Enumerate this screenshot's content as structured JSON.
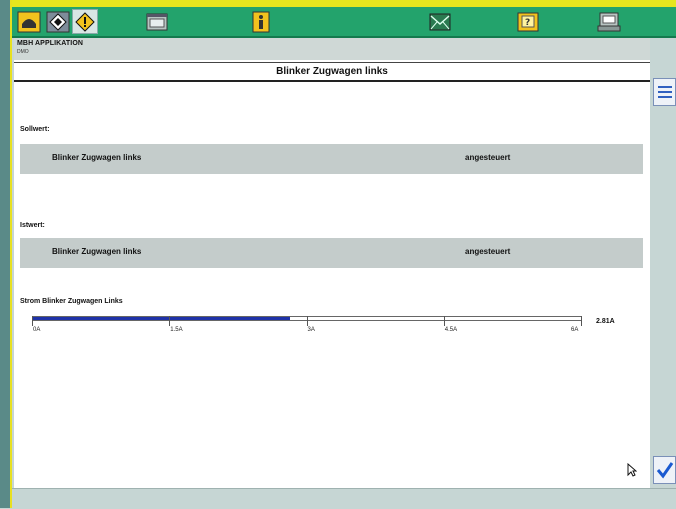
{
  "app": {
    "title": "MBH APPLIKATION",
    "subtitle": "DMO"
  },
  "toolbar": {
    "buttons": [
      {
        "name": "vehicle-icon",
        "color": "#f2c21e"
      },
      {
        "name": "diagnosis-icon",
        "color": "#7e8c9a"
      },
      {
        "name": "warning-diamond-icon",
        "color": "#f2c21e"
      },
      {
        "name": "window-icon",
        "color": "#b8c4c2"
      },
      {
        "name": "info-icon",
        "color": "#f2c21e"
      },
      {
        "name": "message-icon",
        "color": "#2a7a50"
      },
      {
        "name": "help-icon",
        "color": "#f2c21e"
      },
      {
        "name": "print-icon",
        "color": "#b8c4c2"
      }
    ]
  },
  "page": {
    "title": "Blinker Zugwagen links"
  },
  "sollwert": {
    "label": "Sollwert:",
    "name": "Blinker Zugwagen links",
    "state": "angesteuert"
  },
  "istwert": {
    "label": "Istwert:",
    "name": "Blinker Zugwagen links",
    "state": "angesteuert"
  },
  "meter": {
    "label": "Strom Blinker Zugwagen Links",
    "min": 0,
    "max": 6,
    "value": 2.81,
    "value_label": "2.81A",
    "ticks": [
      "0A",
      "1.5A",
      "3A",
      "4.5A",
      "6A"
    ],
    "fill_color": "#1f32a8"
  },
  "side": {
    "list_button": "list-icon",
    "confirm_button": "checkmark-icon"
  }
}
